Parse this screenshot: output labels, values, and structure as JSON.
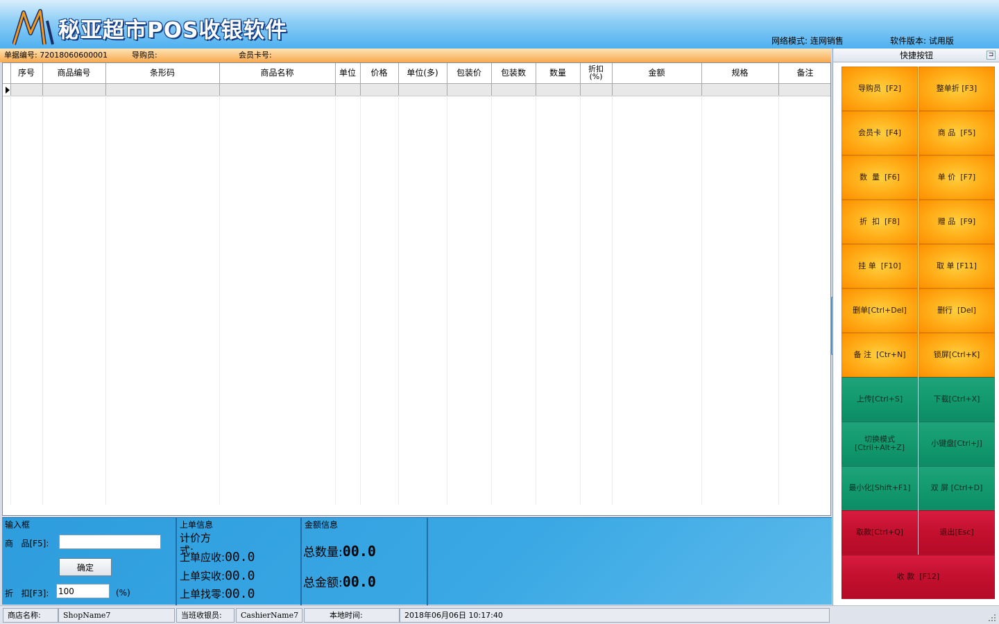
{
  "app": {
    "title": "秘亚超市POS收银软件",
    "network_mode": "网络模式: 连网销售",
    "software_version": "软件版本: 试用版"
  },
  "billbar": {
    "bill_no": "单据编号: 72018060600001",
    "guide": "导购员:",
    "member_card": "会员卡号:"
  },
  "table": {
    "columns": [
      "序号",
      "商品编号",
      "条形码",
      "商品名称",
      "单位",
      "价格",
      "单位(多)",
      "包装价",
      "包装数",
      "数量",
      "折扣\n(%)",
      "金额",
      "规格",
      "备注"
    ]
  },
  "input_box": {
    "title": "输入框",
    "product_label": "商   品[F5]:",
    "product_value": "",
    "confirm_label": "确定",
    "discount_label": "折   扣[F3]:",
    "discount_value": "100",
    "discount_unit": "(%)"
  },
  "last_order": {
    "title": "上单信息",
    "pricing_label": "计价方\n式:",
    "receivable_label": "上单应收:",
    "receivable_value": "00.0",
    "received_label": "上单实收:",
    "received_value": "00.0",
    "change_label": "上单找零:",
    "change_value": "00.0"
  },
  "amount_info": {
    "title": "金额信息",
    "total_qty_label": "总数量:",
    "total_qty_value": "00.0",
    "total_amount_label": "总金额:",
    "total_amount_value": "00.0"
  },
  "quick_panel": {
    "title": "快捷按钮",
    "buttons": [
      {
        "label": "导购员  [F2]",
        "kind": "o"
      },
      {
        "label": "整单折 [F3]",
        "kind": "o"
      },
      {
        "label": "会员卡  [F4]",
        "kind": "o"
      },
      {
        "label": "商 品  [F5]",
        "kind": "o"
      },
      {
        "label": "数  量  [F6]",
        "kind": "o"
      },
      {
        "label": "单 价  [F7]",
        "kind": "o"
      },
      {
        "label": "折  扣  [F8]",
        "kind": "o"
      },
      {
        "label": "赠 品  [F9]",
        "kind": "o"
      },
      {
        "label": "挂 单  [F10]",
        "kind": "o"
      },
      {
        "label": "取 单 [F11]",
        "kind": "o"
      },
      {
        "label": "删单[Ctrl+Del]",
        "kind": "o"
      },
      {
        "label": "删行  [Del]",
        "kind": "o"
      },
      {
        "label": "备 注  [Ctr+N]",
        "kind": "o"
      },
      {
        "label": "锁屏[Ctrl+K]",
        "kind": "o"
      },
      {
        "label": "上传[Ctrl+S]",
        "kind": "g"
      },
      {
        "label": "下载[Ctrl+X]",
        "kind": "g"
      },
      {
        "label": "切换模式\n[Ctril+Alt+Z]",
        "kind": "g"
      },
      {
        "label": "小键盘[Ctrl+J]",
        "kind": "g"
      },
      {
        "label": "最小化[Shift+F1]",
        "kind": "g"
      },
      {
        "label": "双 屏 [Ctrl+D]",
        "kind": "g"
      },
      {
        "label": "取款[Ctrl+Q]",
        "kind": "r"
      },
      {
        "label": "退出[Esc]",
        "kind": "r"
      }
    ],
    "checkout": {
      "label": "收 款  [F12]",
      "kind": "r"
    }
  },
  "status": {
    "shop_label": "商店名称:",
    "shop_value": "ShopName7",
    "cashier_label": "当班收银员:",
    "cashier_value": "CashierName7",
    "time_label": "本地时间:",
    "time_value": "2018年06月06日 10:17:40"
  }
}
